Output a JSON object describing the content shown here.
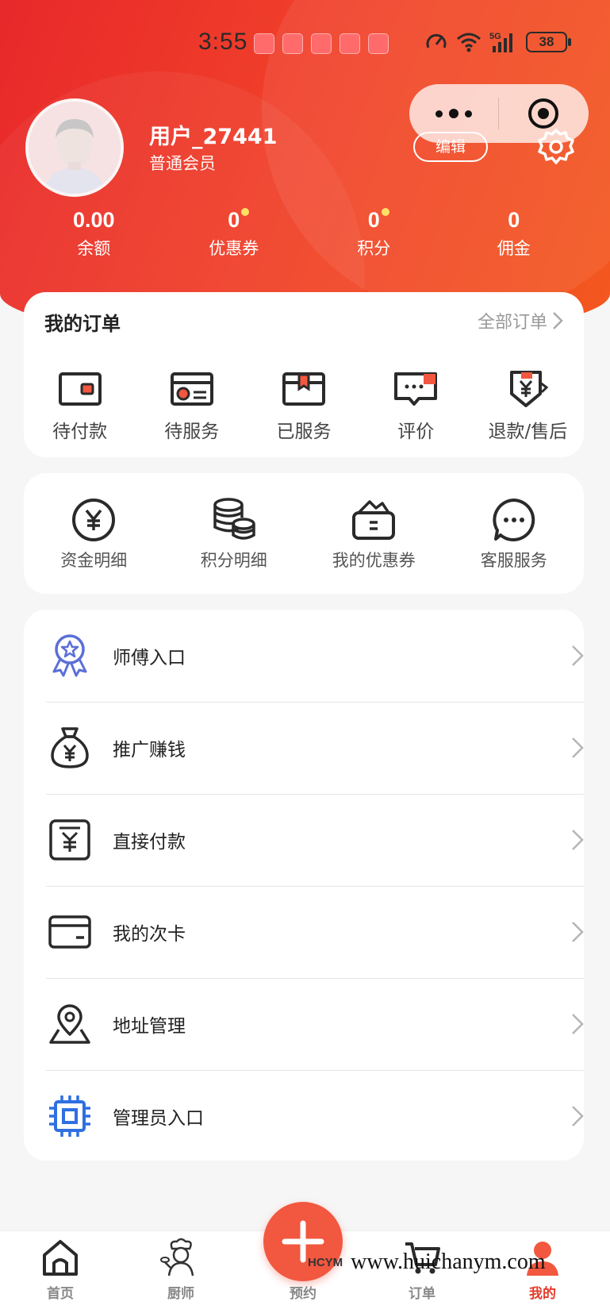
{
  "status_bar": {
    "time": "3:55",
    "battery": "38",
    "network": "5G"
  },
  "profile": {
    "username": "用户_27441",
    "level": "普通会员",
    "edit_label": "编辑"
  },
  "stats": [
    {
      "value": "0.00",
      "label": "余额",
      "dot": false
    },
    {
      "value": "0",
      "label": "优惠券",
      "dot": true
    },
    {
      "value": "0",
      "label": "积分",
      "dot": true
    },
    {
      "value": "0",
      "label": "佣金",
      "dot": false
    }
  ],
  "orders": {
    "title": "我的订单",
    "all_label": "全部订单",
    "items": [
      {
        "label": "待付款",
        "icon": "wallet-icon"
      },
      {
        "label": "待服务",
        "icon": "card-icon"
      },
      {
        "label": "已服务",
        "icon": "box-icon"
      },
      {
        "label": "评价",
        "icon": "comment-icon"
      },
      {
        "label": "退款/售后",
        "icon": "refund-icon"
      }
    ]
  },
  "quick": [
    {
      "label": "资金明细",
      "icon": "yuan-circle-icon"
    },
    {
      "label": "积分明细",
      "icon": "coins-icon"
    },
    {
      "label": "我的优惠券",
      "icon": "coupon-wallet-icon"
    },
    {
      "label": "客服服务",
      "icon": "chat-icon"
    }
  ],
  "menu": [
    {
      "label": "师傅入口",
      "icon": "award-ribbon-icon"
    },
    {
      "label": "推广赚钱",
      "icon": "money-bag-icon"
    },
    {
      "label": "直接付款",
      "icon": "payment-icon"
    },
    {
      "label": "我的次卡",
      "icon": "card-icon"
    },
    {
      "label": "地址管理",
      "icon": "location-pin-icon"
    },
    {
      "label": "管理员入口",
      "icon": "chip-icon"
    }
  ],
  "tabbar": {
    "home": "首页",
    "chef": "厨师",
    "book": "预约",
    "orders": "订单",
    "mine": "我的"
  },
  "watermark": {
    "logo": "HCYM",
    "url": "www.huichanym.com"
  },
  "colors": {
    "brand": "#e8282a",
    "accent": "#f2573f",
    "active_tab": "#e43c2a"
  }
}
